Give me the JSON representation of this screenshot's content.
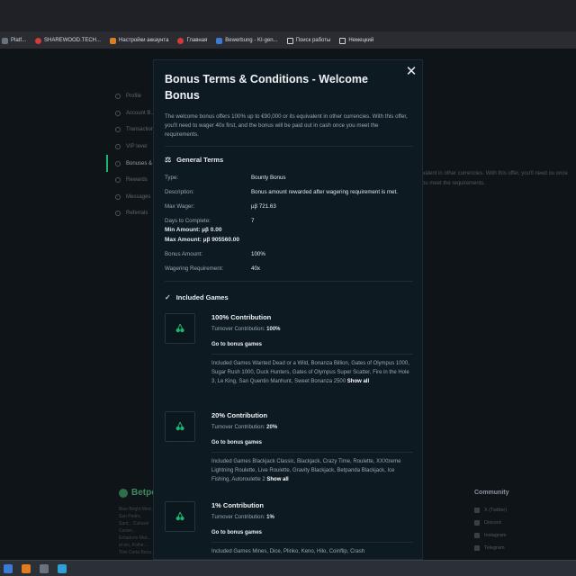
{
  "bookmarks": [
    "Platf...",
    "SHAREWOOD.TECH...",
    "Настройки аккаунта",
    "Главная",
    "Bewerbung - KI-gen...",
    "Поиск работы",
    "Немецкий"
  ],
  "background": {
    "nav": [
      "Profile",
      "Account B...",
      "Transaction",
      "VIP level",
      "Bonuses &",
      "Rewards",
      "Messages",
      "Referrals"
    ],
    "text": "Itvalent in other currencies. With this offer, you'll need ou once you meet the requirements.",
    "brand": "Betpo",
    "footer_text": "Blue Bright Med... San Pedro, Sant... Cultural Center... Emadorio Met... el etc, Kolhe... This Certa Boca...",
    "community": {
      "title": "Community",
      "links": [
        "X (Twitter)",
        "Discord",
        "Instagram",
        "Telegram"
      ]
    }
  },
  "modal": {
    "title": "Bonus Terms & Conditions - Welcome Bonus",
    "intro": "The welcome bonus offers 100% up to €90,000 or its equivalent in other currencies. With this offer, you'll need to wager 40x first, and the bonus will be paid out in cash once you meet the requirements.",
    "general_terms": {
      "heading": "General Terms",
      "rows": [
        {
          "key": "Type:",
          "value": "Bounty Bonus"
        },
        {
          "key": "Description:",
          "value": "Bonus amount rewarded after wagering requirement is met."
        },
        {
          "key": "Max Wager:",
          "value": "µβ 721.63"
        },
        {
          "key": "Days to Complete:",
          "value": "7"
        }
      ],
      "min_amount": "Min Amount: µβ 0.00",
      "max_amount": "Max Amount: µβ 905560.00",
      "rows2": [
        {
          "key": "Bonus Amount:",
          "value": "100%"
        },
        {
          "key": "Wagering Requirement:",
          "value": "40x"
        }
      ]
    },
    "included_games": {
      "heading": "Included Games",
      "groups": [
        {
          "title": "100% Contribution",
          "turnover_label": "Turnover Contribution:",
          "turnover_value": "100%",
          "link": "Go to bonus games",
          "list": "Included Games Wanted Dead or a Wild, Bonanza Billion, Gates of Olympus 1000, Sugar Rush 1000, Duck Hunters, Gates of Olympus Super Scatter, Fire in the Hole 3, Le King, San Quentin Manhunt, Sweet Bonanza 2500",
          "show_all": "Show all"
        },
        {
          "title": "20% Contribution",
          "turnover_label": "Turnover Contribution:",
          "turnover_value": "20%",
          "link": "Go to bonus games",
          "list": "Included Games Blackjack Classic, Blackjack, Crazy Time, Roulette, XXXtreme Lightning Roulette, Live Roulette, Gravity Blackjack, Betpanda Blackjack, Ice Fishing, Autoroulette 2",
          "show_all": "Show all"
        },
        {
          "title": "1% Contribution",
          "turnover_label": "Turnover Contribution:",
          "turnover_value": "1%",
          "link": "Go to bonus games",
          "list": "Included Games Mines, Dice, Plinko, Keno, Hilo, Coinflip, Crash",
          "show_all": ""
        }
      ]
    }
  },
  "colors": {
    "accent": "#1bb56f",
    "modal_bg": "#0e1a22",
    "page_bg": "#0f1419"
  }
}
